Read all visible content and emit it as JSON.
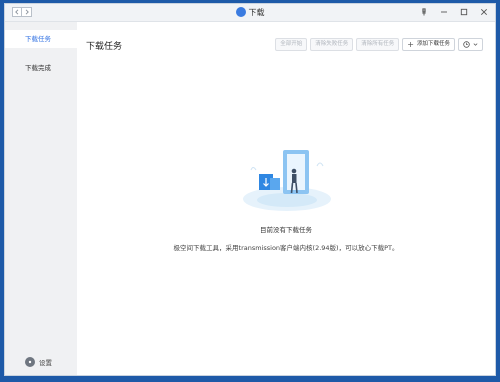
{
  "window": {
    "title": "下载"
  },
  "sidebar": {
    "items": [
      {
        "label": "下载任务",
        "active": true
      },
      {
        "label": "下载完成",
        "active": false
      }
    ],
    "settings_label": "设置"
  },
  "main": {
    "title": "下载任务",
    "toolbar": {
      "start_all": "全部开始",
      "clear_failed": "清除失败任务",
      "clear_all": "清除所有任务",
      "add_task": "添加下载任务"
    },
    "empty": {
      "title": "目前没有下载任务",
      "description": "极空间下载工具，采用transmission客户端内核(2.94版)，可以放心下载PT。"
    }
  },
  "colors": {
    "accent": "#3272e3",
    "desktop": "#1e5aa8"
  },
  "icons": [
    "chevron-left-icon",
    "chevron-right-icon",
    "download-app-icon",
    "pin-icon",
    "minimize-icon",
    "maximize-icon",
    "close-icon",
    "gear-icon",
    "plus-icon",
    "clock-icon",
    "chevron-down-icon"
  ]
}
